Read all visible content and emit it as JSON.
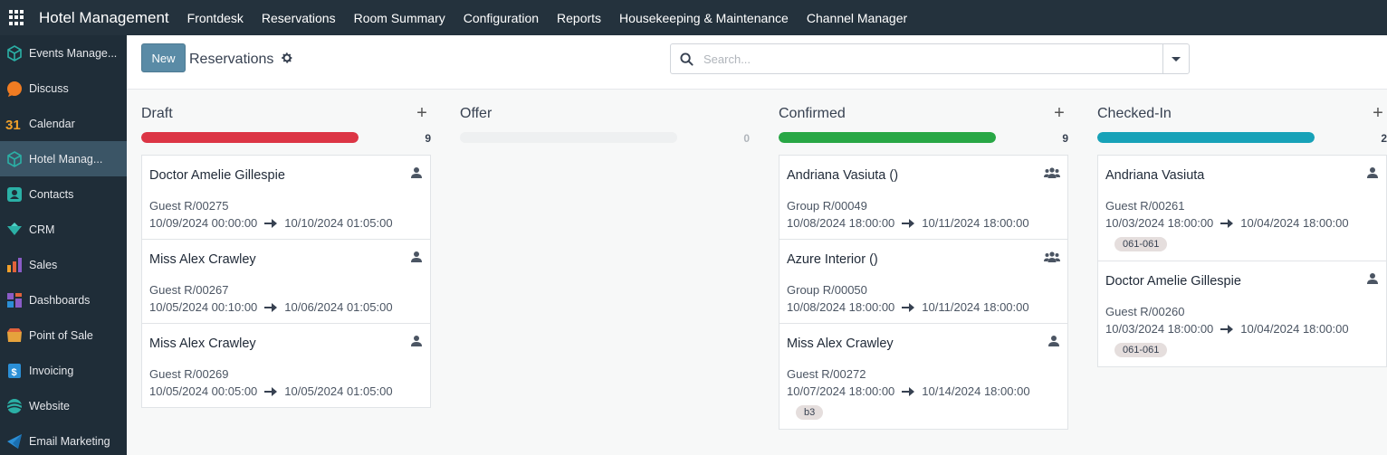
{
  "topbar": {
    "brand": "Hotel Management",
    "nav": [
      "Frontdesk",
      "Reservations",
      "Room Summary",
      "Configuration",
      "Reports",
      "Housekeeping & Maintenance",
      "Channel Manager"
    ]
  },
  "sidebar": {
    "items": [
      {
        "label": "Events Manage...",
        "icon": "cube-icon",
        "color": "#2bb0a6"
      },
      {
        "label": "Discuss",
        "icon": "chat-bubble-icon",
        "color": "#f07c22"
      },
      {
        "label": "Calendar",
        "icon": "calendar-31-icon",
        "color": "#f0a02a"
      },
      {
        "label": "Hotel Manag...",
        "icon": "cube-icon",
        "color": "#2bb0a6"
      },
      {
        "label": "Contacts",
        "icon": "contacts-icon",
        "color": "#2bb0a6"
      },
      {
        "label": "CRM",
        "icon": "crm-diamond-icon",
        "color": "#2bb0a6"
      },
      {
        "label": "Sales",
        "icon": "sales-chart-icon",
        "color": "#e0623c"
      },
      {
        "label": "Dashboards",
        "icon": "dashboard-icon",
        "color": "#8a5cc7"
      },
      {
        "label": "Point of Sale",
        "icon": "shop-icon",
        "color": "#e6a23c"
      },
      {
        "label": "Invoicing",
        "icon": "invoice-dollar-icon",
        "color": "#2b8fd6"
      },
      {
        "label": "Website",
        "icon": "globe-icon",
        "color": "#2bb0a6"
      },
      {
        "label": "Email Marketing",
        "icon": "paper-plane-icon",
        "color": "#2b8fd6"
      }
    ]
  },
  "control": {
    "new_label": "New",
    "title": "Reservations",
    "search_placeholder": "Search..."
  },
  "columns": [
    {
      "title": "Draft",
      "count": "9",
      "color": "#dc3545",
      "fill": 1,
      "cards": [
        {
          "title": "Doctor Amelie Gillespie",
          "sub": "Guest R/00275",
          "start": "10/09/2024 00:00:00",
          "end": "10/10/2024 01:05:00",
          "icon": "person-icon"
        },
        {
          "title": "Miss Alex Crawley",
          "sub": "Guest R/00267",
          "start": "10/05/2024 00:10:00",
          "end": "10/06/2024 01:05:00",
          "icon": "person-icon"
        },
        {
          "title": "Miss Alex Crawley",
          "sub": "Guest R/00269",
          "start": "10/05/2024 00:05:00",
          "end": "10/05/2024 01:05:00",
          "icon": "person-icon"
        }
      ]
    },
    {
      "title": "Offer",
      "count": "0",
      "color": "#eef0f1",
      "fill": 0,
      "cards": []
    },
    {
      "title": "Confirmed",
      "count": "9",
      "color": "#28a745",
      "fill": 1,
      "cards": [
        {
          "title": "Andriana Vasiuta ()",
          "sub": "Group R/00049",
          "start": "10/08/2024 18:00:00",
          "end": "10/11/2024 18:00:00",
          "icon": "group-icon"
        },
        {
          "title": "Azure Interior ()",
          "sub": "Group R/00050",
          "start": "10/08/2024 18:00:00",
          "end": "10/11/2024 18:00:00",
          "icon": "group-icon"
        },
        {
          "title": "Miss Alex Crawley",
          "sub": "Guest R/00272",
          "start": "10/07/2024 18:00:00",
          "end": "10/14/2024 18:00:00",
          "icon": "person-icon",
          "tag": "b3"
        }
      ]
    },
    {
      "title": "Checked-In",
      "count": "2",
      "color": "#17a2b8",
      "fill": 1,
      "cards": [
        {
          "title": "Andriana Vasiuta",
          "sub": "Guest R/00261",
          "start": "10/03/2024 18:00:00",
          "end": "10/04/2024 18:00:00",
          "icon": "person-icon",
          "tag": "061-061"
        },
        {
          "title": "Doctor Amelie Gillespie",
          "sub": "Guest R/00260",
          "start": "10/03/2024 18:00:00",
          "end": "10/04/2024 18:00:00",
          "icon": "person-icon",
          "tag": "061-061"
        }
      ]
    }
  ]
}
